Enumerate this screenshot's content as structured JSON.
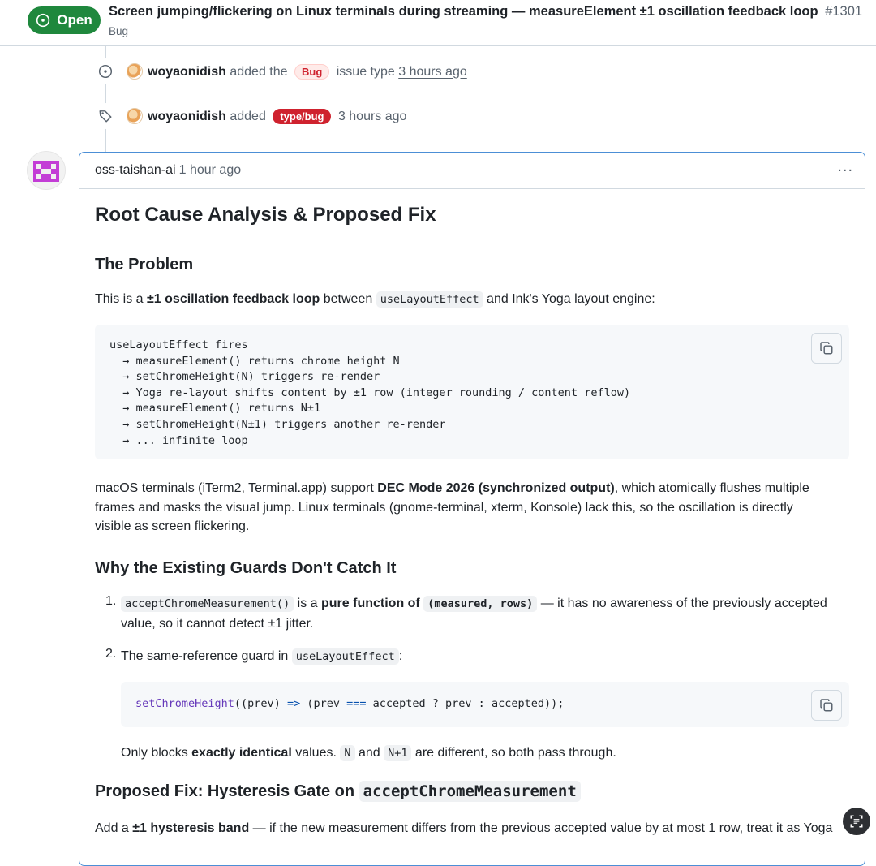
{
  "issue": {
    "state": "Open",
    "title": "Screen jumping/flickering on Linux terminals during streaming — measureElement ±1 oscillation feedback loop",
    "number": "#1301",
    "type": "Bug"
  },
  "timeline": [
    {
      "icon": "issue-type-icon",
      "user": "woyaonidish",
      "verb": "added the",
      "label": "Bug",
      "suffix": "issue type",
      "time": "3 hours ago"
    },
    {
      "icon": "tag-icon",
      "user": "woyaonidish",
      "verb": "added",
      "label": "type/bug",
      "time": "3 hours ago"
    }
  ],
  "comment": {
    "author": "oss-taishan-ai",
    "time": "1 hour ago",
    "menu": "...",
    "h1": "Root Cause Analysis & Proposed Fix",
    "problem_heading": "The Problem",
    "p1": {
      "pre": "This is a ",
      "bold": "±1 oscillation feedback loop",
      "mid": " between ",
      "code": "useLayoutEffect",
      "post": " and Ink's Yoga layout engine:"
    },
    "code1": [
      "useLayoutEffect fires",
      "  → measureElement() returns chrome height N",
      "  → setChromeHeight(N) triggers re-render",
      "  → Yoga re-layout shifts content by ±1 row (integer rounding / content reflow)",
      "  → measureElement() returns N±1",
      "  → setChromeHeight(N±1) triggers another re-render",
      "  → ... infinite loop"
    ],
    "p2": {
      "pre": "macOS terminals (iTerm2, Terminal.app) support ",
      "bold": "DEC Mode 2026 (synchronized output)",
      "post1": ", which atomically flushes multiple",
      "line2": "frames and masks the visual jump. Linux terminals (gnome-terminal, xterm, Konsole) lack this, so the oscillation is directly",
      "line3": "visible as screen flickering."
    },
    "guards_heading": "Why the Existing Guards Don't Catch It",
    "item1": {
      "num": "1.",
      "code": "acceptChromeMeasurement()",
      "mid": " is a ",
      "bold": "pure function of ",
      "boldcode": "(measured, rows)",
      "post": " — it has no awareness of the previously accepted",
      "line2": "value, so it cannot detect ±1 jitter."
    },
    "item2": {
      "num": "2.",
      "pre": "The same-reference guard in ",
      "code": "useLayoutEffect",
      "post": ":"
    },
    "code2": {
      "fn": "setChromeHeight",
      "a": "((prev) ",
      "arrow": "=>",
      "b": " (prev ",
      "eq": "===",
      "c": " accepted ? prev : accepted));"
    },
    "p3": {
      "pre": "Only blocks ",
      "bold": "exactly identical",
      "mid": " values. ",
      "code1": "N",
      "and": " and ",
      "code2": "N+1",
      "post": " are different, so both pass through."
    },
    "fix_heading": {
      "pre": "Proposed Fix: Hysteresis Gate on ",
      "code": "acceptChromeMeasurement"
    },
    "p4": {
      "pre": "Add a ",
      "bold": "±1 hysteresis band",
      "post": " — if the new measurement differs from the previous accepted value by at most 1 row, treat it as Yoga"
    }
  }
}
